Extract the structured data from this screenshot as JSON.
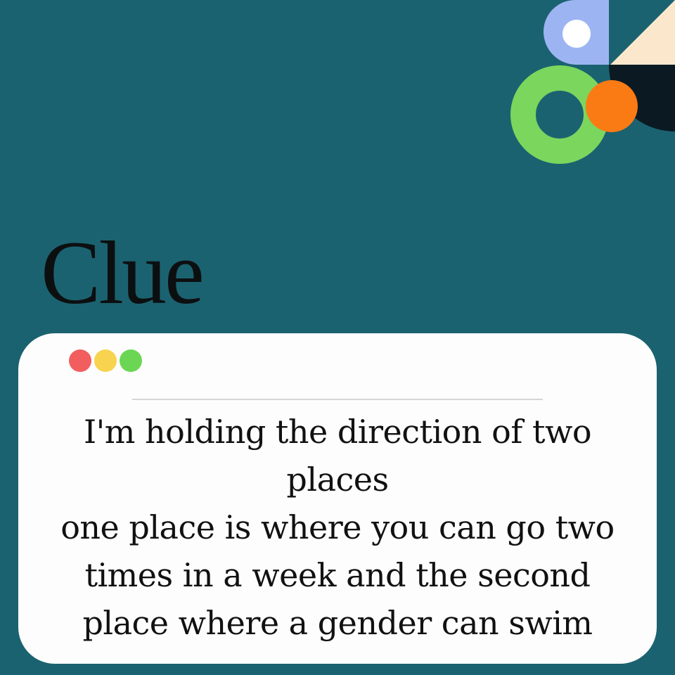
{
  "colors": {
    "background": "#1b6270",
    "card": "#fdfdfd",
    "title_text": "#0c0f10",
    "body_text": "#111111",
    "divider": "#d6d6d6",
    "decor_blue": "#9db4f2",
    "decor_cream": "#fbe8cc",
    "decor_dark": "#0b1a22",
    "decor_green": "#7bd65e",
    "decor_orange": "#fa7a14",
    "dot_red": "#f25e5e",
    "dot_yellow": "#f8d34f",
    "dot_green": "#6bd654"
  },
  "decor_icons": [
    "blue-rounded-square-with-hole",
    "cream-triangle",
    "dark-quarter-circle",
    "green-ring",
    "orange-circle"
  ],
  "title": "Clue",
  "window": {
    "dots": [
      {
        "name": "red-dot",
        "color": "#f25e5e"
      },
      {
        "name": "yellow-dot",
        "color": "#f8d34f"
      },
      {
        "name": "green-dot",
        "color": "#6bd654"
      }
    ],
    "lines": [
      "I'm holding the direction of two",
      "places",
      "one place is where you can go two",
      "times in a week and the second",
      "place where a gender can swim"
    ]
  }
}
